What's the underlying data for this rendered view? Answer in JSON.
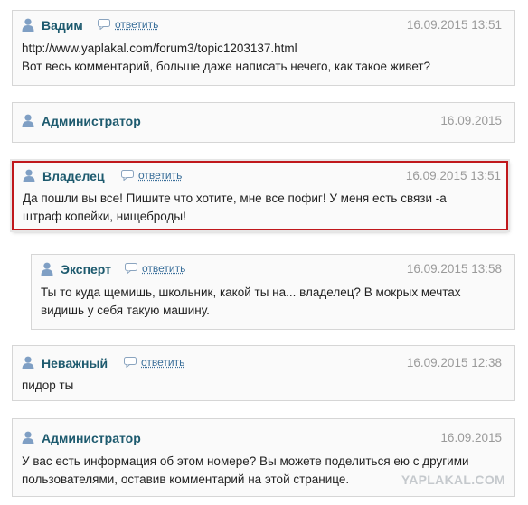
{
  "reply_label": "ответить",
  "watermark": "YAPLAKAL.COM",
  "comments": [
    {
      "author": "Вадим",
      "date": "16.09.2015 13:51",
      "lines": [
        "http://www.yaplakal.com/forum3/topic1203137.html",
        "Вот весь комментарий, больше даже написать нечего, как такое живет?"
      ]
    },
    {
      "author": "Администратор",
      "date": "16.09.2015",
      "lines": []
    },
    {
      "author": "Владелец",
      "date": "16.09.2015 13:51",
      "lines": [
        "Да пошли вы все! Пишите что хотите, мне все пофиг! У меня есть связи -а",
        "штраф копейки, нищеброды!"
      ]
    },
    {
      "author": "Эксперт",
      "date": "16.09.2015 13:58",
      "lines": [
        "Ты то куда щемишь, школьник, какой ты на... владелец? В мокрых мечтах",
        "видишь у себя такую машину."
      ]
    },
    {
      "author": "Неважный",
      "date": "16.09.2015 12:38",
      "lines": [
        "пидор ты"
      ]
    },
    {
      "author": "Администратор",
      "date": "16.09.2015",
      "lines": [
        "У вас есть информация об этом номере? Вы можете поделиться ею с другими",
        "пользователями, оставив комментарий на этой странице."
      ]
    }
  ],
  "colors": {
    "author": "#1d5a6e",
    "reply_link": "#3a6f9a",
    "date": "#9a9a9a",
    "highlight_border": "#c0181c",
    "box_border": "#d6d6d6",
    "box_bg": "#fafafa",
    "watermark": "#c5c9cd"
  },
  "icons": {
    "author": "user-icon",
    "reply": "speech-bubble-icon"
  }
}
